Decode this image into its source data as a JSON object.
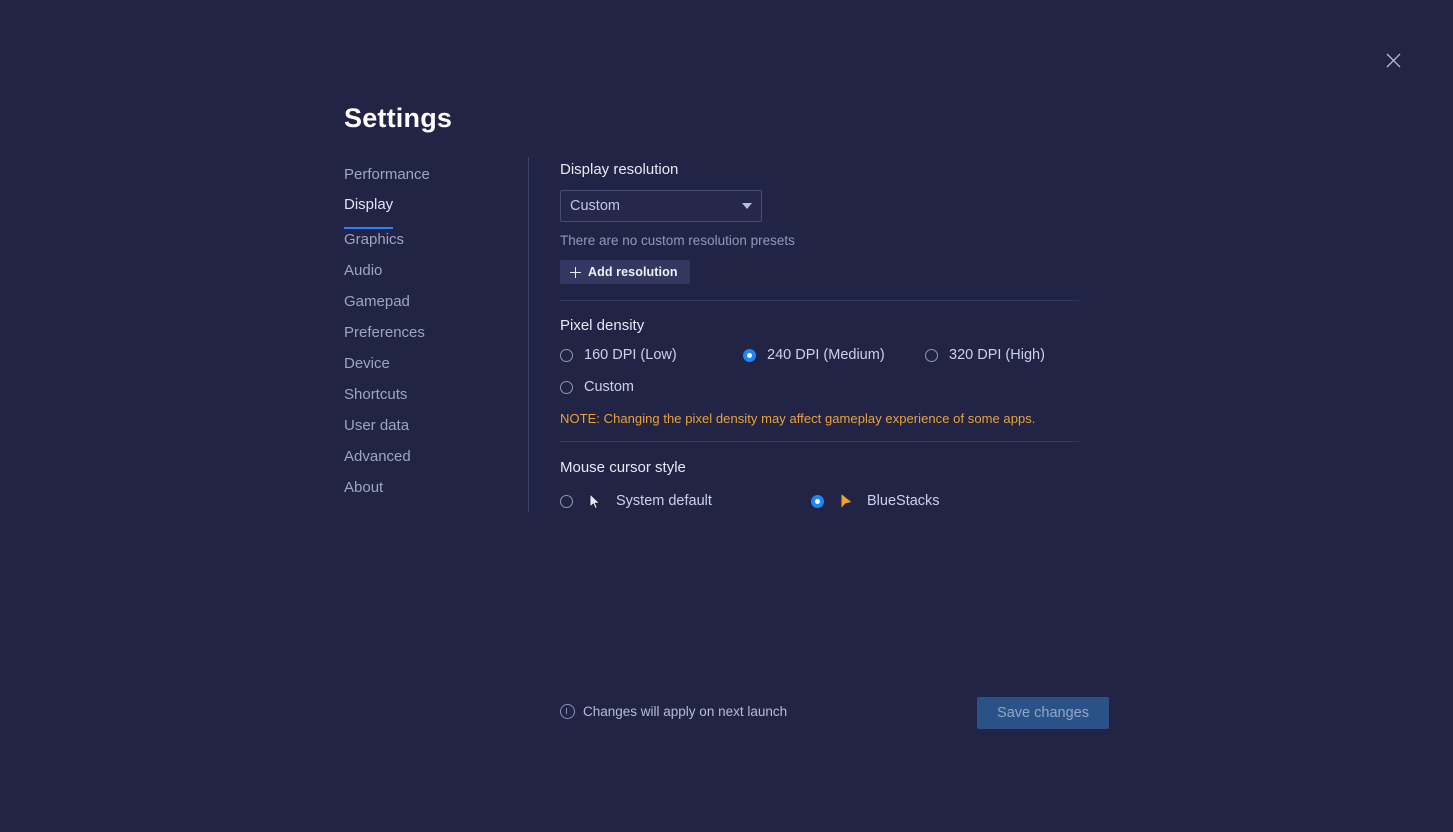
{
  "window": {
    "title": "Settings",
    "close_icon": "close-icon"
  },
  "sidebar": {
    "items": [
      {
        "label": "Performance",
        "active": false
      },
      {
        "label": "Display",
        "active": true
      },
      {
        "label": "Graphics",
        "active": false
      },
      {
        "label": "Audio",
        "active": false
      },
      {
        "label": "Gamepad",
        "active": false
      },
      {
        "label": "Preferences",
        "active": false
      },
      {
        "label": "Device",
        "active": false
      },
      {
        "label": "Shortcuts",
        "active": false
      },
      {
        "label": "User data",
        "active": false
      },
      {
        "label": "Advanced",
        "active": false
      },
      {
        "label": "About",
        "active": false
      }
    ]
  },
  "display_resolution": {
    "title": "Display resolution",
    "dropdown_value": "Custom",
    "dropdown_options": [
      "Custom"
    ],
    "empty_text": "There are no custom resolution presets",
    "add_button_label": "Add resolution"
  },
  "pixel_density": {
    "title": "Pixel density",
    "options": [
      {
        "label": "160 DPI (Low)",
        "selected": false
      },
      {
        "label": "240 DPI (Medium)",
        "selected": true
      },
      {
        "label": "320 DPI (High)",
        "selected": false
      },
      {
        "label": "Custom",
        "selected": false
      }
    ],
    "note": "NOTE: Changing the pixel density may affect gameplay experience of some apps.",
    "note_color": "#e8a33d"
  },
  "mouse_cursor_style": {
    "title": "Mouse cursor style",
    "options": [
      {
        "label": "System default",
        "selected": false,
        "icon": "cursor-arrow-white-icon"
      },
      {
        "label": "BlueStacks",
        "selected": true,
        "icon": "cursor-arrow-orange-icon"
      }
    ]
  },
  "footer": {
    "note": "Changes will apply on next launch",
    "info_icon": "info-circle-icon",
    "save_label": "Save changes",
    "save_enabled": false
  },
  "colors": {
    "background": "#222445",
    "accent_blue": "#1f86f5",
    "warning_amber": "#e8a33d",
    "save_button": "#2a5287",
    "cursor_orange": "#f0a32a"
  }
}
